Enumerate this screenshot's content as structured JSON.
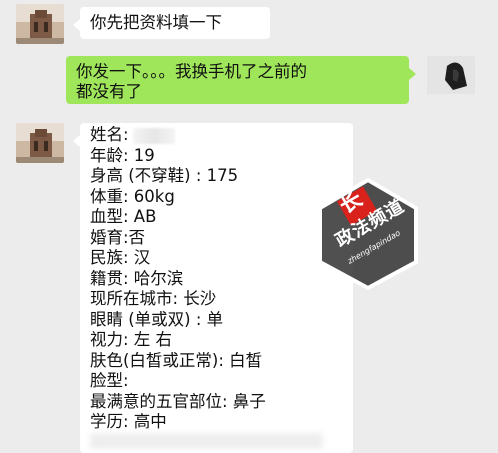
{
  "messages": {
    "m1": "你先把资料填一下",
    "m2_line1": "你发一下。。。我换手机了之前的",
    "m2_line2": "都没有了"
  },
  "form": {
    "lines": [
      "姓名:",
      "年龄: 19",
      "身高 (不穿鞋) : 175",
      "体重: 60kg",
      "血型: AB",
      "婚育:否",
      "民族: 汉",
      "籍贯: 哈尔滨",
      "现所在城市: 长沙",
      "眼睛 (单或双) : 单",
      "视力: 左 右",
      "肤色(白皙或正常): 白皙",
      "脸型:",
      "最满意的五官部位: 鼻子",
      "学历: 高中"
    ]
  },
  "watermark": {
    "logo_char": "长",
    "name": "政法频道",
    "sub": "zhengfapindao"
  },
  "colors": {
    "background": "#ececec",
    "sent_bubble": "#9fe65a",
    "received_bubble": "#ffffff",
    "watermark_red": "#d9221c"
  }
}
